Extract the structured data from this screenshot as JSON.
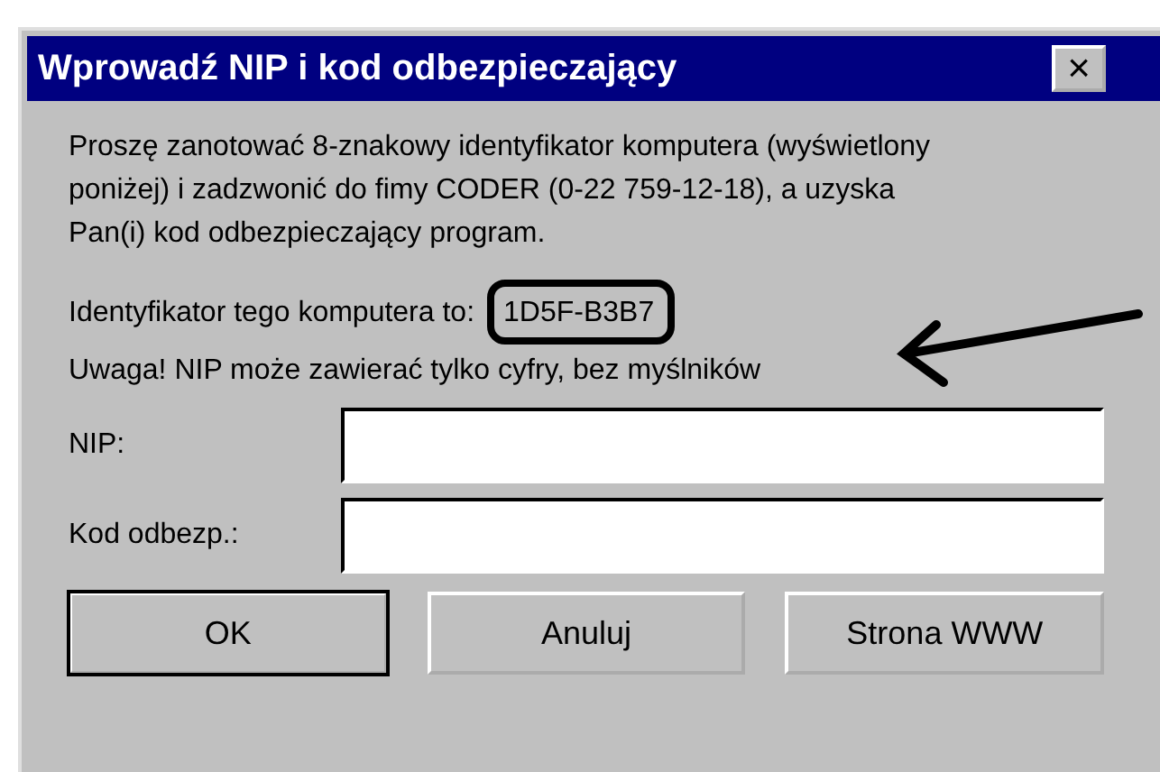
{
  "window": {
    "title": "Wprowadź NIP i kod odbezpieczający",
    "close": "×"
  },
  "message": "Proszę zanotować 8-znakowy identyfikator komputera (wyświetlony poniżej) i zadzwonić do fimy CODER (0-22 759-12-18), a uzyska Pan(i) kod odbezpieczający program.",
  "identifier": {
    "label": "Identyfikator tego komputera to:",
    "value": "1D5F-B3B7"
  },
  "warning": "Uwaga! NIP może zawierać tylko cyfry, bez myślników",
  "fields": [
    {
      "label": "NIP:"
    },
    {
      "label": "Kod odbezp.:"
    }
  ],
  "buttons": [
    {
      "label": "OK",
      "default": true
    },
    {
      "label": "Anuluj",
      "default": false
    },
    {
      "label": "Strona WWW",
      "default": false
    }
  ]
}
